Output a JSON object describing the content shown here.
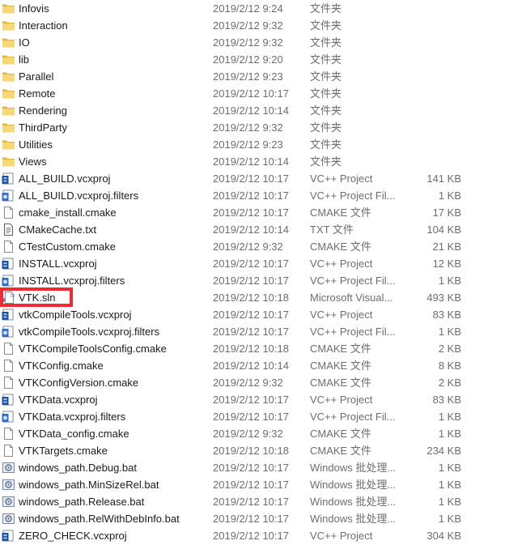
{
  "colors": {
    "annotation_box": "#ee2a36",
    "folder": "#f5c542",
    "vcxproj": "#1f4fa3"
  },
  "files": [
    {
      "name": "Infovis",
      "date": "2019/2/12 9:24",
      "type": "文件夹",
      "size": "",
      "icon": "folder-icon"
    },
    {
      "name": "Interaction",
      "date": "2019/2/12 9:32",
      "type": "文件夹",
      "size": "",
      "icon": "folder-icon"
    },
    {
      "name": "IO",
      "date": "2019/2/12 9:32",
      "type": "文件夹",
      "size": "",
      "icon": "folder-icon"
    },
    {
      "name": "lib",
      "date": "2019/2/12 9:20",
      "type": "文件夹",
      "size": "",
      "icon": "folder-icon"
    },
    {
      "name": "Parallel",
      "date": "2019/2/12 9:23",
      "type": "文件夹",
      "size": "",
      "icon": "folder-icon"
    },
    {
      "name": "Remote",
      "date": "2019/2/12 10:17",
      "type": "文件夹",
      "size": "",
      "icon": "folder-icon"
    },
    {
      "name": "Rendering",
      "date": "2019/2/12 10:14",
      "type": "文件夹",
      "size": "",
      "icon": "folder-icon"
    },
    {
      "name": "ThirdParty",
      "date": "2019/2/12 9:32",
      "type": "文件夹",
      "size": "",
      "icon": "folder-icon"
    },
    {
      "name": "Utilities",
      "date": "2019/2/12 9:23",
      "type": "文件夹",
      "size": "",
      "icon": "folder-icon"
    },
    {
      "name": "Views",
      "date": "2019/2/12 10:14",
      "type": "文件夹",
      "size": "",
      "icon": "folder-icon"
    },
    {
      "name": "ALL_BUILD.vcxproj",
      "date": "2019/2/12 10:17",
      "type": "VC++ Project",
      "size": "141 KB",
      "icon": "vcxproj-icon"
    },
    {
      "name": "ALL_BUILD.vcxproj.filters",
      "date": "2019/2/12 10:17",
      "type": "VC++ Project Fil...",
      "size": "1 KB",
      "icon": "vcxproj-filters-icon"
    },
    {
      "name": "cmake_install.cmake",
      "date": "2019/2/12 10:17",
      "type": "CMAKE 文件",
      "size": "17 KB",
      "icon": "generic-file-icon"
    },
    {
      "name": "CMakeCache.txt",
      "date": "2019/2/12 10:14",
      "type": "TXT 文件",
      "size": "104 KB",
      "icon": "text-file-icon"
    },
    {
      "name": "CTestCustom.cmake",
      "date": "2019/2/12 9:32",
      "type": "CMAKE 文件",
      "size": "21 KB",
      "icon": "generic-file-icon"
    },
    {
      "name": "INSTALL.vcxproj",
      "date": "2019/2/12 10:17",
      "type": "VC++ Project",
      "size": "12 KB",
      "icon": "vcxproj-icon"
    },
    {
      "name": "INSTALL.vcxproj.filters",
      "date": "2019/2/12 10:17",
      "type": "VC++ Project Fil...",
      "size": "1 KB",
      "icon": "vcxproj-filters-icon"
    },
    {
      "name": "VTK.sln",
      "date": "2019/2/12 10:18",
      "type": "Microsoft Visual...",
      "size": "493 KB",
      "icon": "solution-file-icon"
    },
    {
      "name": "vtkCompileTools.vcxproj",
      "date": "2019/2/12 10:17",
      "type": "VC++ Project",
      "size": "83 KB",
      "icon": "vcxproj-icon"
    },
    {
      "name": "vtkCompileTools.vcxproj.filters",
      "date": "2019/2/12 10:17",
      "type": "VC++ Project Fil...",
      "size": "1 KB",
      "icon": "vcxproj-filters-icon"
    },
    {
      "name": "VTKCompileToolsConfig.cmake",
      "date": "2019/2/12 10:18",
      "type": "CMAKE 文件",
      "size": "2 KB",
      "icon": "generic-file-icon"
    },
    {
      "name": "VTKConfig.cmake",
      "date": "2019/2/12 10:14",
      "type": "CMAKE 文件",
      "size": "8 KB",
      "icon": "generic-file-icon"
    },
    {
      "name": "VTKConfigVersion.cmake",
      "date": "2019/2/12 9:32",
      "type": "CMAKE 文件",
      "size": "2 KB",
      "icon": "generic-file-icon"
    },
    {
      "name": "VTKData.vcxproj",
      "date": "2019/2/12 10:17",
      "type": "VC++ Project",
      "size": "83 KB",
      "icon": "vcxproj-icon"
    },
    {
      "name": "VTKData.vcxproj.filters",
      "date": "2019/2/12 10:17",
      "type": "VC++ Project Fil...",
      "size": "1 KB",
      "icon": "vcxproj-filters-icon"
    },
    {
      "name": "VTKData_config.cmake",
      "date": "2019/2/12 9:32",
      "type": "CMAKE 文件",
      "size": "1 KB",
      "icon": "generic-file-icon"
    },
    {
      "name": "VTKTargets.cmake",
      "date": "2019/2/12 10:18",
      "type": "CMAKE 文件",
      "size": "234 KB",
      "icon": "generic-file-icon"
    },
    {
      "name": "windows_path.Debug.bat",
      "date": "2019/2/12 10:17",
      "type": "Windows 批处理...",
      "size": "1 KB",
      "icon": "batch-file-icon"
    },
    {
      "name": "windows_path.MinSizeRel.bat",
      "date": "2019/2/12 10:17",
      "type": "Windows 批处理...",
      "size": "1 KB",
      "icon": "batch-file-icon"
    },
    {
      "name": "windows_path.Release.bat",
      "date": "2019/2/12 10:17",
      "type": "Windows 批处理...",
      "size": "1 KB",
      "icon": "batch-file-icon"
    },
    {
      "name": "windows_path.RelWithDebInfo.bat",
      "date": "2019/2/12 10:17",
      "type": "Windows 批处理...",
      "size": "1 KB",
      "icon": "batch-file-icon"
    },
    {
      "name": "ZERO_CHECK.vcxproj",
      "date": "2019/2/12 10:17",
      "type": "VC++ Project",
      "size": "304 KB",
      "icon": "vcxproj-icon"
    }
  ]
}
